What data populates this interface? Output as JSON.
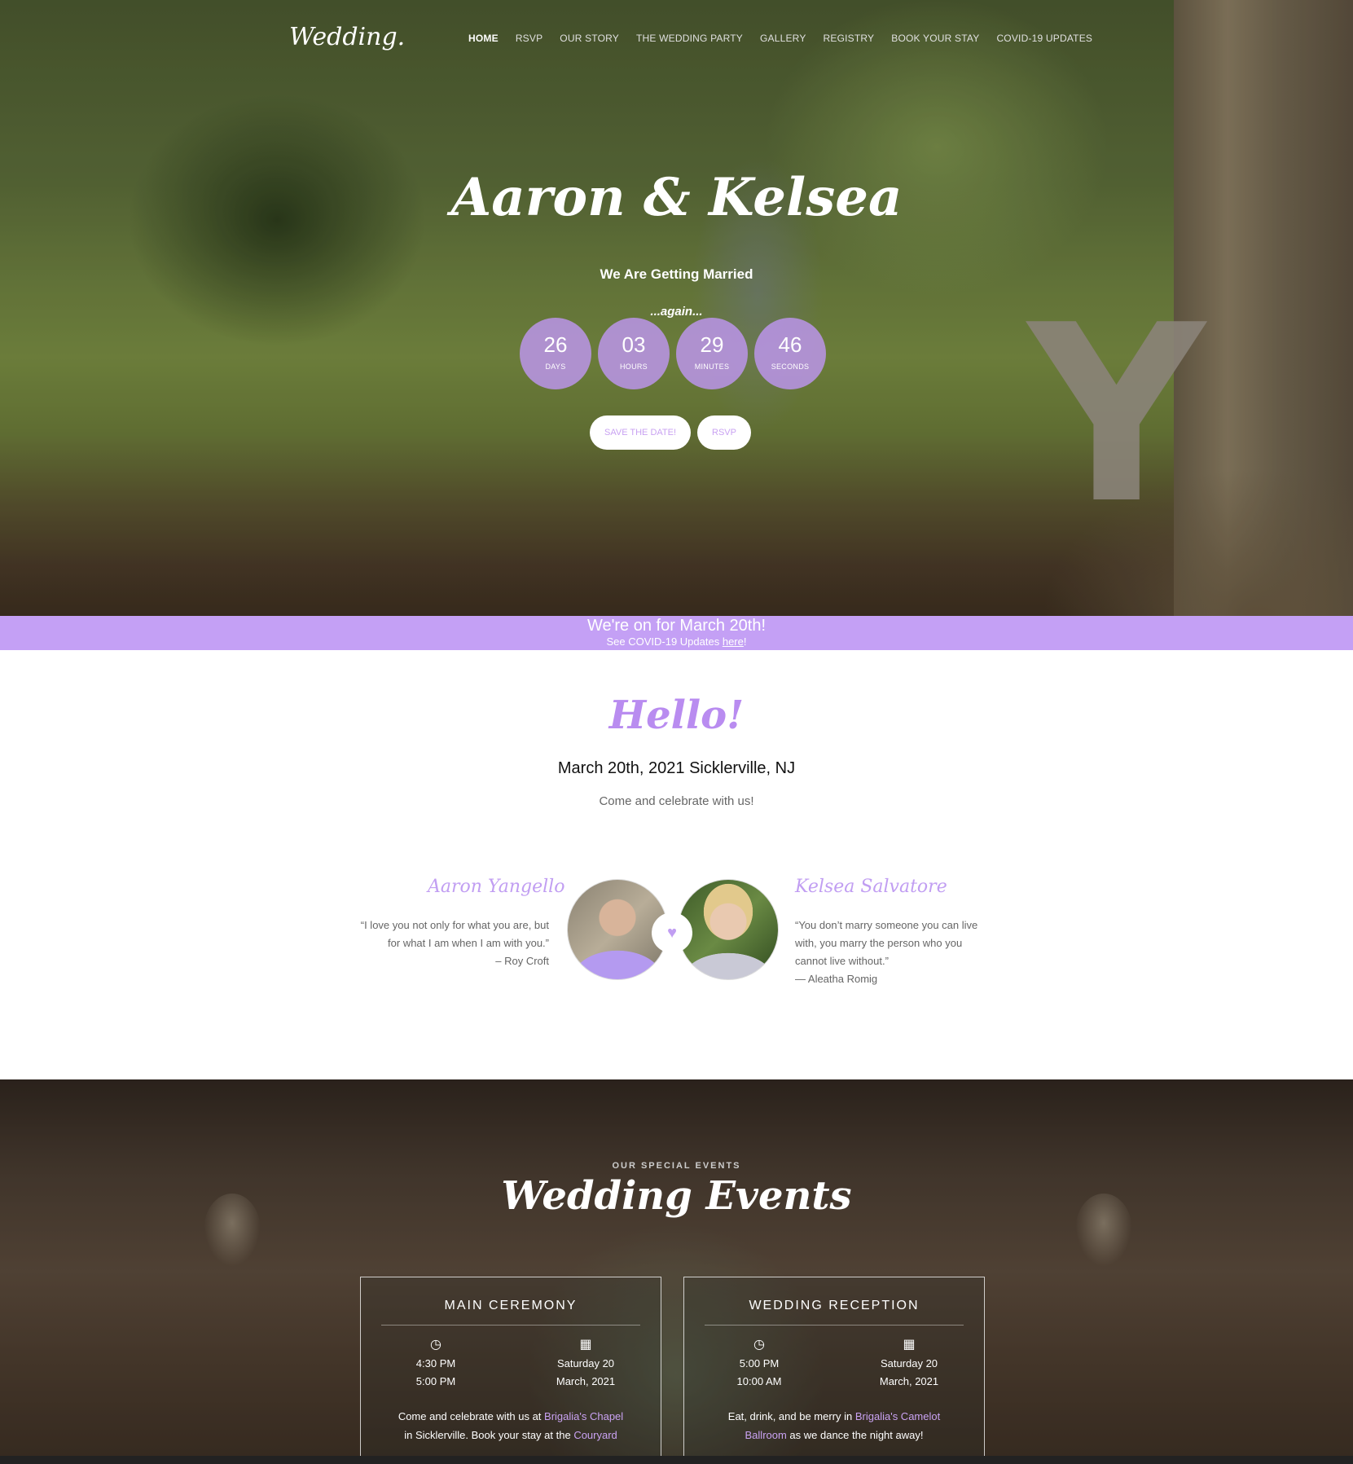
{
  "nav": {
    "logo": "Wedding.",
    "items": [
      "HOME",
      "RSVP",
      "OUR STORY",
      "THE WEDDING PARTY",
      "GALLERY",
      "REGISTRY",
      "BOOK YOUR STAY",
      "COVID-19 UPDATES"
    ],
    "active": "HOME"
  },
  "hero": {
    "title": "Aaron & Kelsea",
    "subtitle": "We Are Getting Married",
    "again": "...again...",
    "countdown": [
      {
        "value": "26",
        "label": "DAYS"
      },
      {
        "value": "03",
        "label": "HOURS"
      },
      {
        "value": "29",
        "label": "MINUTES"
      },
      {
        "value": "46",
        "label": "SECONDS"
      }
    ],
    "buttons": {
      "save_the_date": "SAVE THE DATE!",
      "rsvp": "RSVP"
    }
  },
  "banner": {
    "headline": "We're on for March 20th!",
    "line_prefix": "See COVID-19 Updates ",
    "link": "here",
    "line_suffix": "!"
  },
  "hello": {
    "title": "Hello!",
    "date_place": "March 20th, 2021 Sicklerville, NJ",
    "sub": "Come and celebrate with us!"
  },
  "groom": {
    "name": "Aaron Yangello",
    "quote_1": "“I love you not only for what you are, but",
    "quote_2": "for what I am when I am with you.”",
    "author": "– Roy Croft"
  },
  "bride": {
    "name": "Kelsea Salvatore",
    "quote_1": "“You don’t marry someone you can live",
    "quote_2": "with, you marry the person who you",
    "quote_3": "cannot live without.”",
    "author": "— Aleatha Romig"
  },
  "events": {
    "kicker": "OUR SPECIAL EVENTS",
    "title": "Wedding Events",
    "cards": [
      {
        "title": "MAIN CEREMONY",
        "time_1": "4:30 PM",
        "time_2": "5:00 PM",
        "date_1": "Saturday 20",
        "date_2": "March, 2021",
        "desc_1": "Come and celebrate with us at ",
        "link_1": "Brigalia's Chapel",
        "desc_2": "in Sicklerville. Book your stay at the ",
        "link_2": "Couryard"
      },
      {
        "title": "WEDDING RECEPTION",
        "time_1": "5:00 PM",
        "time_2": "10:00 AM",
        "date_1": "Saturday 20",
        "date_2": "March, 2021",
        "desc_1": "Eat, drink, and be merry in ",
        "link_1": "Brigalia's Camelot",
        "link_1b": "Ballroom",
        "desc_2": " as we dance the night away!"
      }
    ]
  },
  "colors": {
    "accent": "#c4a0f5",
    "accent_text": "#b98cf0"
  },
  "icons": {
    "clock": "clock-icon",
    "calendar": "calendar-icon",
    "heart": "heart-icon"
  }
}
